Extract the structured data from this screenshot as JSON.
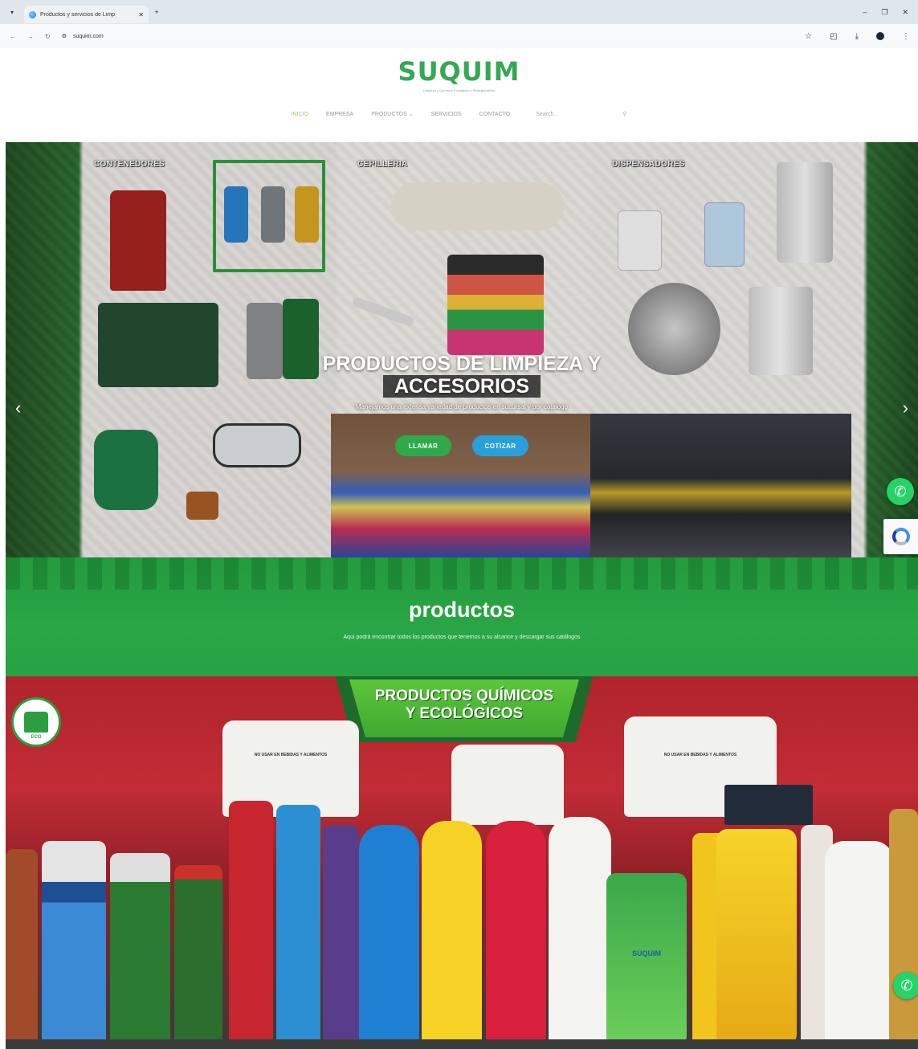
{
  "browser": {
    "tab_title": "Productos y servicios de Limp",
    "url": "suquim.com"
  },
  "site": {
    "logo": "SUQUIM",
    "logo_tagline": "Limpieza y Químicos Ecológicos y Biodegradables",
    "nav": {
      "items": [
        "INICIO",
        "EMPRESA",
        "PRODUCTOS",
        "SERVICIOS",
        "CONTACTO"
      ],
      "search_placeholder": "Search..."
    }
  },
  "hero": {
    "panels": [
      "CONTENEDORES",
      "CEPILLERIA",
      "DISPENSADORES"
    ],
    "title_line1": "PRODUCTOS DE LIMPIEZA Y",
    "title_line2": "ACCESORIOS",
    "subtitle": "Manejamos una extensa variedad de productos en sucursal y por catalogo",
    "buttons": {
      "call": "LLAMAR",
      "quote": "COTIZAR"
    }
  },
  "products": {
    "title": "productos",
    "subtitle": "Aqui podrá encontrar todos los productos que tenemos a su alcance y descargar sus catálogos"
  },
  "banner": {
    "title_line1": "PRODUCTOS QUÍMICOS",
    "title_line2": "Y ECOLÓGICOS",
    "eco_badge": "ECO",
    "jug_label": "NO USAR EN BEBIDAS Y ALIMENTOS",
    "bottle_brand": "SUQUIM"
  },
  "colors": {
    "brand_green": "#34a853",
    "call_button": "#2eaa4a",
    "quote_button": "#29a0d9",
    "banner_red": "#c22c35",
    "whatsapp": "#25d366"
  }
}
